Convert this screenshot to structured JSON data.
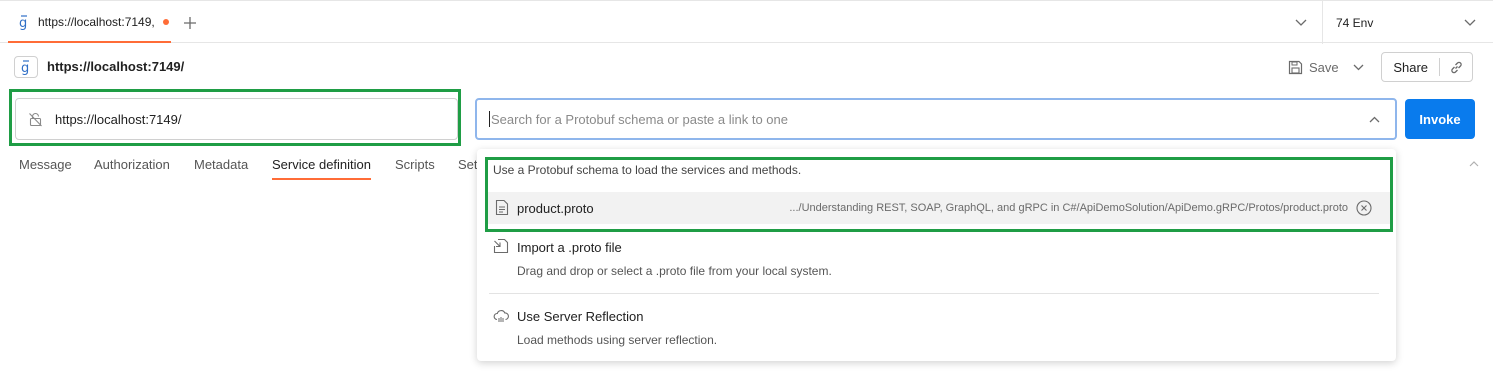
{
  "tabs": [
    {
      "title": "https://localhost:7149,",
      "unsaved": true
    }
  ],
  "environment": {
    "label": "74 Env"
  },
  "request": {
    "name": "https://localhost:7149/",
    "url": "https://localhost:7149/",
    "save_label": "Save",
    "share_label": "Share",
    "invoke_label": "Invoke"
  },
  "schema": {
    "placeholder": "Search for a Protobuf schema or paste a link to one"
  },
  "subtabs": [
    "Message",
    "Authorization",
    "Metadata",
    "Service definition",
    "Scripts",
    "Set"
  ],
  "active_subtab": "Service definition",
  "dropdown": {
    "hint": "Use a Protobuf schema to load the services and methods.",
    "recent": {
      "name": "product.proto",
      "path": ".../Understanding REST, SOAP, GraphQL, and gRPC in C#/ApiDemoSolution/ApiDemo.gRPC/Protos/product.proto"
    },
    "options": [
      {
        "title": "Import a .proto file",
        "description": "Drag and drop or select a .proto file from your local system.",
        "icon": "import-file-icon"
      },
      {
        "title": "Use Server Reflection",
        "description": "Load methods using server reflection.",
        "icon": "cloud-reflection-icon"
      }
    ]
  },
  "colors": {
    "accent": "#ff6c37",
    "primary": "#097bed",
    "highlight": "#1f9d45",
    "focus_border": "#8fb6ec"
  }
}
